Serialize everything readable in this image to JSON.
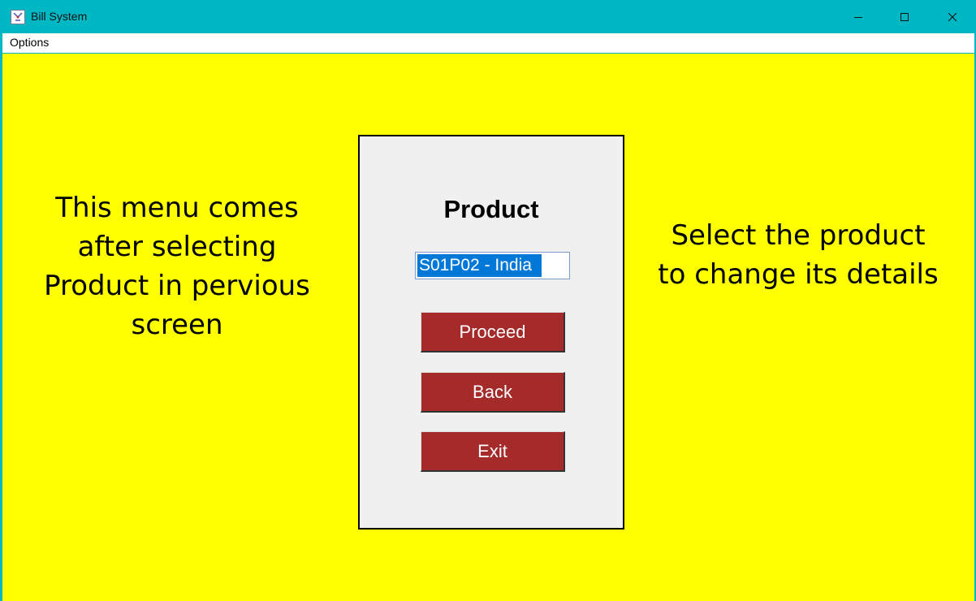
{
  "window": {
    "title": "Bill System",
    "title_bar_color": "#00b8c4",
    "icons": [
      "app-icon",
      "minimize-icon",
      "maximize-icon",
      "close-icon"
    ]
  },
  "menu": {
    "items": [
      {
        "label": "Options"
      }
    ]
  },
  "canvas": {
    "background": "#ffff00"
  },
  "notes": {
    "left": "This menu comes\nafter selecting\nProduct in pervious\nscreen",
    "right": "Select the product\nto change its details"
  },
  "panel": {
    "title": "Product",
    "product_select": {
      "selected_value": "S01P02 - India"
    },
    "buttons": {
      "proceed": "Proceed",
      "back": "Back",
      "exit": "Exit"
    },
    "button_color": "#a52a2a"
  }
}
